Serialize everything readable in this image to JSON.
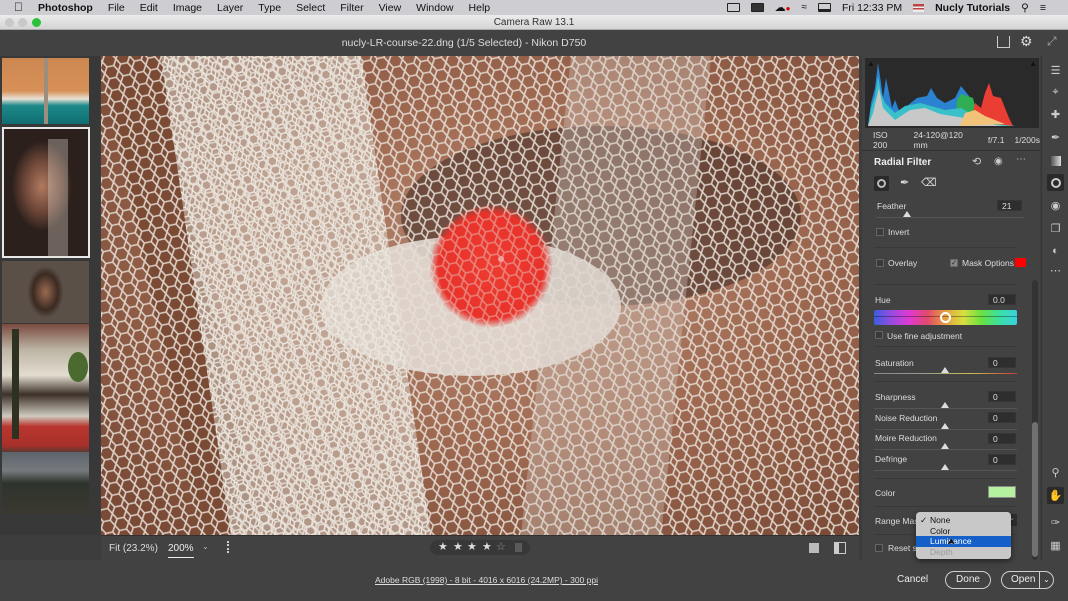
{
  "menubar": {
    "app": "Photoshop",
    "items": [
      "File",
      "Edit",
      "Image",
      "Layer",
      "Type",
      "Select",
      "Filter",
      "View",
      "Window",
      "Help"
    ],
    "clock": "Fri 12:33 PM",
    "user": "Nucly Tutorials"
  },
  "window": {
    "title": "Camera Raw 13.1"
  },
  "header": {
    "file_title": "nucly-LR-course-22.dng (1/5 Selected)  -  Nikon D750"
  },
  "filmstrip": {
    "thumbs": [
      {
        "name": "aerial-beach"
      },
      {
        "name": "portrait-veil",
        "selected": true
      },
      {
        "name": "portrait-curly-hair"
      },
      {
        "name": "building-facade"
      },
      {
        "name": "landscape-dusk"
      }
    ]
  },
  "exif": {
    "iso": "ISO 200",
    "lens": "24-120@120 mm",
    "aperture": "f/7.1",
    "shutter": "1/200s"
  },
  "panel": {
    "title": "Radial Filter",
    "feather": {
      "label": "Feather",
      "value": "21",
      "position": 0.21
    },
    "invert": {
      "label": "Invert",
      "checked": false
    },
    "overlay": {
      "label": "Overlay",
      "checked": false
    },
    "mask_options": {
      "label": "Mask Options",
      "checked": true,
      "color": "#ff0000"
    },
    "hue": {
      "label": "Hue",
      "value": "0.0",
      "position": 0.5
    },
    "fine_adjust": {
      "label": "Use fine adjustment",
      "checked": false
    },
    "saturation": {
      "label": "Saturation",
      "value": "0",
      "position": 0.5
    },
    "sharpness": {
      "label": "Sharpness",
      "value": "0",
      "position": 0.5
    },
    "noise": {
      "label": "Noise Reduction",
      "value": "0",
      "position": 0.5
    },
    "moire": {
      "label": "Moire Reduction",
      "value": "0",
      "position": 0.5
    },
    "defringe": {
      "label": "Defringe",
      "value": "0",
      "position": 0.5
    },
    "color": {
      "label": "Color",
      "swatch": "#b4f2a0"
    },
    "range_mask": {
      "label": "Range Mask",
      "visible_label": "Range Mask"
    },
    "reset": {
      "label": "Reset sl"
    }
  },
  "dropdown": {
    "options": [
      {
        "label": "None",
        "checked": true
      },
      {
        "label": "Color"
      },
      {
        "label": "Luminance",
        "highlighted": true
      },
      {
        "label": "Depth",
        "disabled": true
      }
    ]
  },
  "imagebar": {
    "fit": "Fit (23.2%)",
    "zoom": "200%",
    "rating": 4,
    "rating_max": 5
  },
  "status": {
    "info": "Adobe RGB (1998) - 8 bit - 4016 x 6016 (24.2MP) - 300 ppi",
    "cancel": "Cancel",
    "done": "Done",
    "open": "Open"
  }
}
